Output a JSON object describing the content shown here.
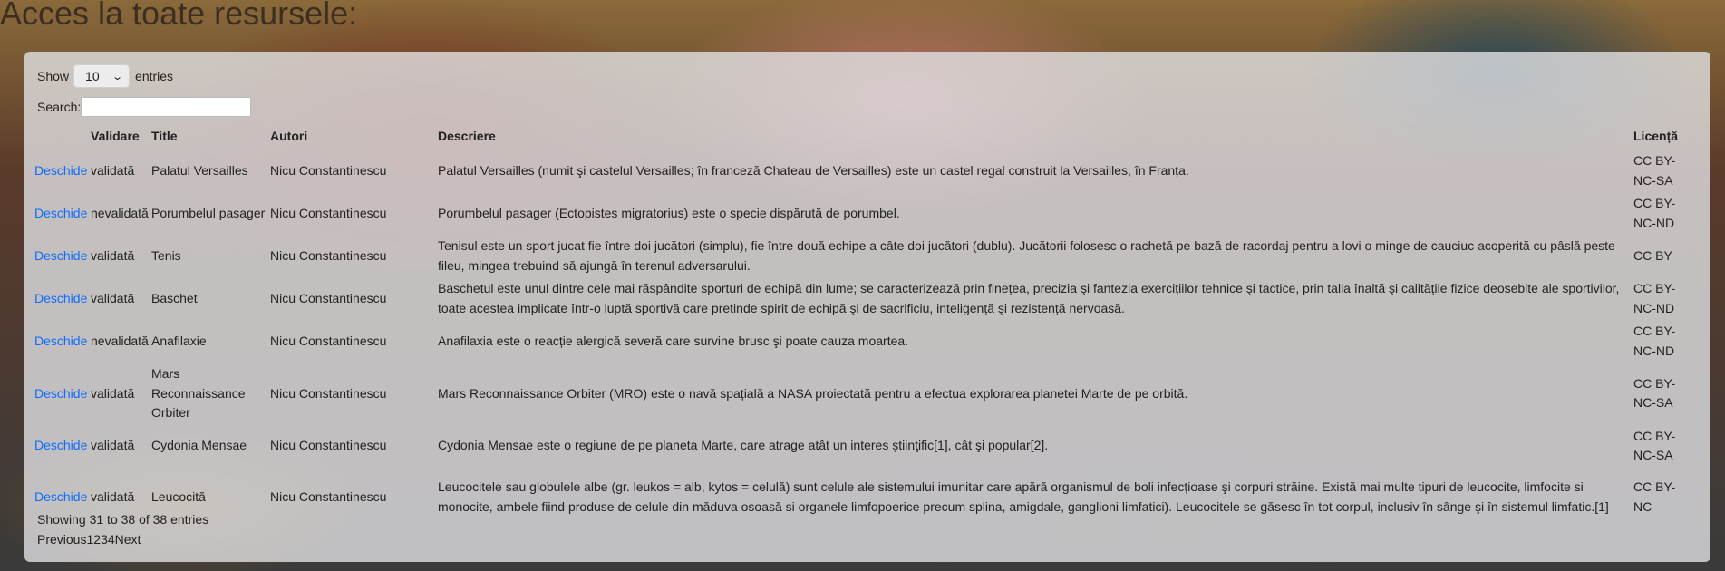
{
  "page": {
    "title": "Acces la toate resursele:"
  },
  "controls": {
    "show_label": "Show",
    "page_length": "10",
    "entries_label": "entries",
    "search_label": "Search:",
    "search_value": ""
  },
  "table": {
    "headers": [
      "",
      "Validare",
      "Title",
      "Autori",
      "Descriere",
      "Licență"
    ],
    "rows": [
      {
        "action": "Deschide",
        "status": "validată",
        "title": "Palatul Versailles",
        "authors": "Nicu Constantinescu",
        "description": "Palatul Versailles (numit şi castelul Versailles; în franceză Chateau de Versailles) este un castel regal construit la Versailles, în Franța.",
        "license": "CC BY-NC-SA"
      },
      {
        "action": "Deschide",
        "status": "nevalidată",
        "title": "Porumbelul pasager",
        "authors": "Nicu Constantinescu",
        "description": "Porumbelul pasager (Ectopistes migratorius) este o specie dispărută de porumbel.",
        "license": "CC BY-NC-ND"
      },
      {
        "action": "Deschide",
        "status": "validată",
        "title": "Tenis",
        "authors": "Nicu Constantinescu",
        "description": "Tenisul este un sport jucat fie între doi jucători (simplu), fie între două echipe a câte doi jucători (dublu). Jucătorii folosesc o rachetă pe bază de racordaj pentru a lovi o minge de cauciuc acoperită cu pâslă peste fileu, mingea trebuind să ajungă în terenul adversarului.",
        "license": "CC BY"
      },
      {
        "action": "Deschide",
        "status": "validată",
        "title": "Baschet",
        "authors": "Nicu Constantinescu",
        "description": "Baschetul este unul dintre cele mai răspândite sporturi de echipă din lume; se caracterizează prin finețea, precizia şi fantezia exercițiilor tehnice şi tactice, prin talia înaltă şi calitățile fizice deosebite ale sportivilor, toate acestea implicate într-o luptă sportivă care pretinde spirit de echipă şi de sacrificiu, inteligență şi rezistență nervoasă.",
        "license": "CC BY-NC-ND"
      },
      {
        "action": "Deschide",
        "status": "nevalidată",
        "title": "Anafilaxie",
        "authors": "Nicu Constantinescu",
        "description": "Anafilaxia este o reacție alergică severă care survine brusc şi poate cauza moartea.",
        "license": "CC BY-NC-ND"
      },
      {
        "action": "Deschide",
        "status": "validată",
        "title": "Mars Reconnaissance Orbiter",
        "authors": "Nicu Constantinescu",
        "description": "Mars Reconnaissance Orbiter (MRO) este o navă spațială a NASA proiectată pentru a efectua explorarea planetei Marte de pe orbită.",
        "license": "CC BY-NC-SA"
      },
      {
        "action": "Deschide",
        "status": "validată",
        "title": "Cydonia Mensae",
        "authors": "Nicu Constantinescu",
        "description": "Cydonia Mensae este o regiune de pe planeta Marte, care atrage atât un interes ştiinţific[1], cât şi popular[2].",
        "license": "CC BY-NC-SA"
      },
      {
        "action": "Deschide",
        "status": "validată",
        "title": "Leucocită",
        "authors": "Nicu Constantinescu",
        "description": "Leucocitele sau globulele albe (gr. leukos = alb, kytos = celulă) sunt celule ale sistemului imunitar care apără organismul de boli infecțioase şi corpuri străine. Există mai multe tipuri de leucocite, limfocite si monocite, ambele fiind produse de celule din măduva osoasă si organele limfopoerice precum splina, amigdale, ganglioni limfatici). Leucocitele se găsesc în tot corpul, inclusiv în sânge şi în sistemul limfatic.[1]",
        "license": "CC BY-NC"
      }
    ]
  },
  "footer": {
    "info": "Showing 31 to 38 of 38 entries",
    "pager": [
      "Previous",
      "1",
      "2",
      "3",
      "4",
      "Next"
    ]
  },
  "colors": {
    "link": "#0d6efd"
  },
  "icons": {
    "select_caret": "chevron-down-icon"
  }
}
